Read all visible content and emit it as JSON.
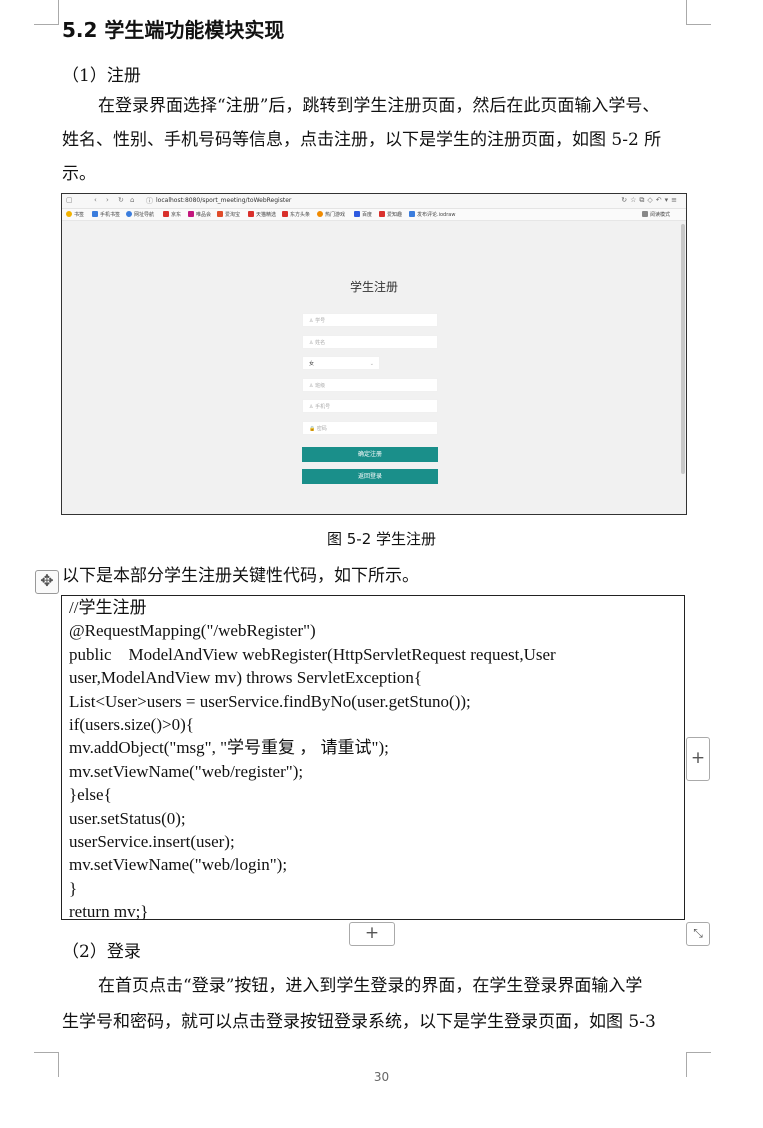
{
  "section_title": "5.2 学生端功能模块实现",
  "sub1": "（1）注册",
  "para1": [
    "在登录界面选择“注册”后，跳转到学生注册页面，然后在此页面输入学号、",
    "姓名、性别、手机号码等信息，点击注册，以下是学生的注册页面，如图 5-2 所",
    "示。"
  ],
  "screenshot": {
    "url": "localhost:8080/sport_meeting/toWebRegister",
    "bookmarks": [
      "书签",
      "手机书签",
      "网址导航",
      "京东",
      "唯品会",
      "爱淘宝",
      "天猫精选",
      "东方头条",
      "热门游戏",
      "百度",
      "爱知趣",
      "发布评论.iodraw"
    ],
    "bookmark_colors": [
      "#f2b200",
      "#3b7ddd",
      "#3b7ddd",
      "#d9302c",
      "#c2167d",
      "#e04c2a",
      "#d9302c",
      "#d9302c",
      "#f08a00",
      "#2f5be0",
      "#d9302c",
      "#3b7ddd"
    ],
    "reading_mode": "阅读模式",
    "title": "学生注册",
    "fields": [
      "学号",
      "姓名",
      "女",
      "班级",
      "手机号",
      "密码"
    ],
    "confirm": "确定注册",
    "back": "返回登录"
  },
  "caption": "图 5-2 学生注册",
  "code_intro": "以下是本部分学生注册关键性代码，如下所示。",
  "code_lines": [
    "//学生注册",
    "@RequestMapping(\"/webRegister\")",
    "public    ModelAndView webRegister(HttpServletRequest request,User",
    "user,ModelAndView mv) throws ServletException{",
    "List<User>users = userService.findByNo(user.getStuno());",
    "if(users.size()>0){",
    "mv.addObject(\"msg\", \"学号重复 ， 请重试\");",
    "mv.setViewName(\"web/register\");",
    "}else{",
    "user.setStatus(0);",
    "userService.insert(user);",
    "mv.setViewName(\"web/login\");",
    "}",
    "return mv;}"
  ],
  "sub2": "（2）登录",
  "para2": [
    "在首页点击“登录”按钮，进入到学生登录的界面，在学生登录界面输入学",
    "生学号和密码，就可以点击登录按钮登录系统，以下是学生登录页面，如图 5-3"
  ],
  "page_number": "30",
  "plus_symbol": "+"
}
